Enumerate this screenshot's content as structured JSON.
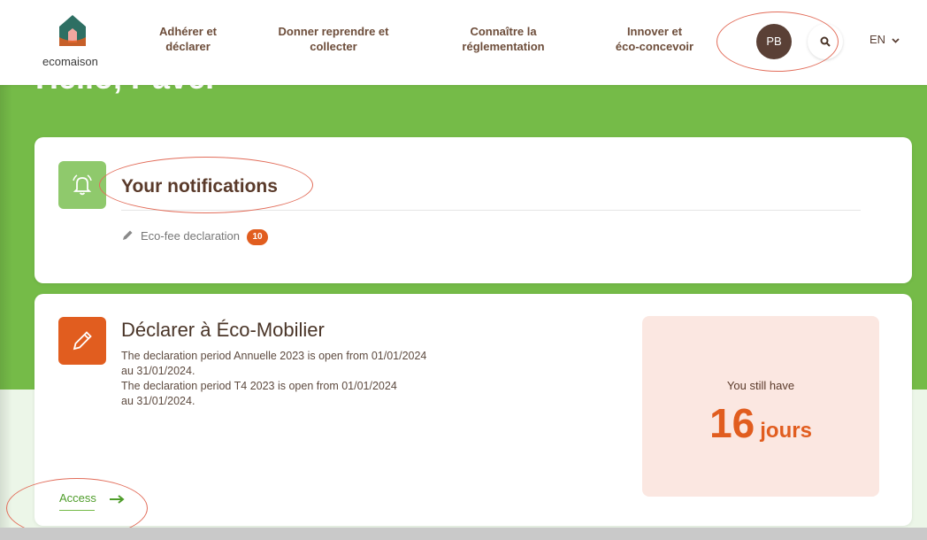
{
  "header": {
    "logo_text": "ecomaison",
    "nav": [
      {
        "line1": "Adhérer et",
        "line2": "déclarer"
      },
      {
        "line1": "Donner reprendre et",
        "line2": "collecter"
      },
      {
        "line1": "Connaître la",
        "line2": "réglementation"
      },
      {
        "line1": "Innover et",
        "line2": "éco-concevoir"
      }
    ],
    "avatar_initials": "PB",
    "language": "EN"
  },
  "greeting": "Hello, Pavel",
  "notifications": {
    "title": "Your notifications",
    "items": [
      {
        "label": "Eco-fee declaration",
        "count": "10"
      }
    ]
  },
  "declare": {
    "title": "Déclarer à Éco-Mobilier",
    "lines": [
      "The declaration period Annuelle 2023 is open from 01/01/2024",
      "au 31/01/2024.",
      "The declaration period T4 2023 is open from 01/01/2024",
      "au 31/01/2024."
    ],
    "countdown": {
      "caption": "You still have",
      "value": "16",
      "unit": "jours"
    },
    "access_label": "Access"
  },
  "colors": {
    "primary_green": "#75bb48",
    "accent_orange": "#e15d1f",
    "brown": "#5a4036"
  },
  "icons": [
    "search-icon",
    "bell-icon",
    "pencil-icon",
    "chevron-down-icon",
    "arrow-right-icon"
  ]
}
